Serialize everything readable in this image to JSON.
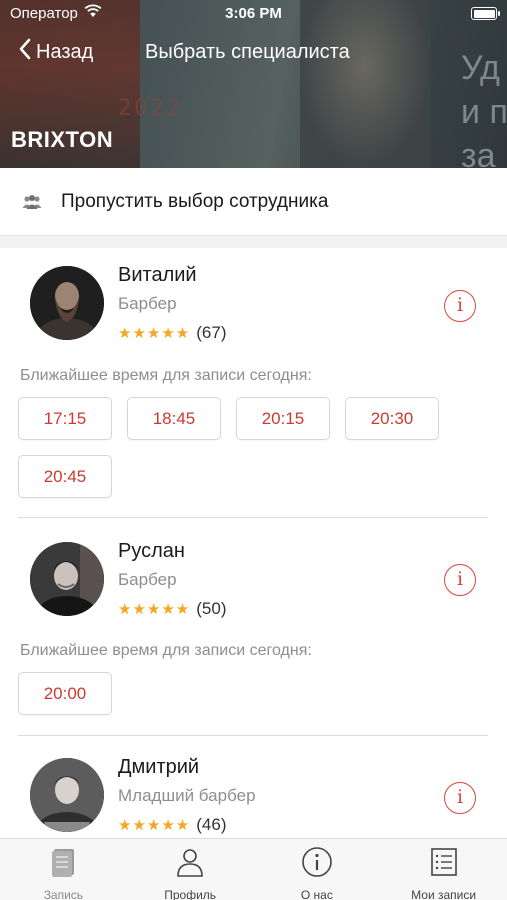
{
  "status_bar": {
    "carrier": "Оператор",
    "time": "3:06 PM"
  },
  "nav": {
    "back_label": "Назад",
    "title": "Выбрать специалиста"
  },
  "header": {
    "brand": "BRIXTON",
    "bg_year": "2022",
    "bg_text": "Уд\nи пр\nза"
  },
  "skip": {
    "label": "Пропустить выбор сотрудника"
  },
  "nearest_label": "Ближайшее время для записи сегодня:",
  "accent_color": "#cc3a30",
  "star_color": "#f5a623",
  "specialists": [
    {
      "name": "Виталий",
      "role": "Барбер",
      "stars": "★★★★★",
      "count": "(67)",
      "slots": [
        "17:15",
        "18:45",
        "20:15",
        "20:30",
        "20:45"
      ]
    },
    {
      "name": "Руслан",
      "role": "Барбер",
      "stars": "★★★★★",
      "count": "(50)",
      "slots": [
        "20:00"
      ]
    },
    {
      "name": "Дмитрий",
      "role": "Младший барбер",
      "stars": "★★★★★",
      "count": "(46)",
      "slots": []
    }
  ],
  "tabs": [
    {
      "label": "Запись",
      "icon": "book-icon",
      "active": true
    },
    {
      "label": "Профиль",
      "icon": "person-icon",
      "active": false
    },
    {
      "label": "О нас",
      "icon": "info-icon",
      "active": false
    },
    {
      "label": "Мои записи",
      "icon": "list-icon",
      "active": false
    }
  ]
}
